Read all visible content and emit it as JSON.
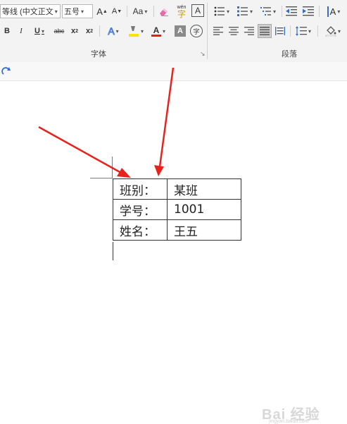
{
  "ribbon": {
    "font_group": {
      "font_name": "等线 (中文正文",
      "font_size": "五号",
      "grow_font": "A",
      "shrink_font": "A",
      "change_case": "Aa",
      "pinyin_top": "wén",
      "pinyin_char": "字",
      "char_border": "A",
      "bold": "B",
      "italic": "I",
      "underline": "U",
      "strikethrough": "abc",
      "subscript": "x",
      "subscript_mark": "2",
      "superscript": "x",
      "superscript_mark": "2",
      "text_effects": "A",
      "font_color": "A",
      "char_shading": "A",
      "enclose_char": "字",
      "label": "字体"
    },
    "paragraph_group": {
      "label": "段落",
      "chinese_layout": "A"
    },
    "colors": {
      "highlight": "#f6e500",
      "font_color": "#e02020",
      "selected_bg": "#cfcfcf"
    }
  },
  "quick_access": {
    "redo_icon": "redo-icon"
  },
  "document": {
    "table": [
      {
        "key": "班别：",
        "value": "某班"
      },
      {
        "key": "学号：",
        "value": "1001"
      },
      {
        "key": "姓名：",
        "value": "王五"
      }
    ],
    "annotation_color": "#e8231d"
  },
  "watermark": {
    "text": "Bai 经验",
    "sub": "jingyan.baidu.com"
  }
}
